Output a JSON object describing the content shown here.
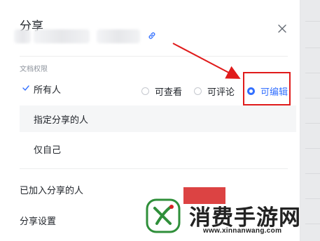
{
  "dialog": {
    "title": "分享",
    "close_icon": "close-icon",
    "link_icon": "link-icon"
  },
  "permissions": {
    "section_label": "文档权限",
    "rows": [
      {
        "label": "所有人",
        "checked": true
      },
      {
        "label": "指定分享的人",
        "checked": false
      },
      {
        "label": "仅自己",
        "checked": false
      }
    ],
    "options": [
      {
        "label": "可查看",
        "selected": false
      },
      {
        "label": "可评论",
        "selected": false
      },
      {
        "label": "可编辑",
        "selected": true
      }
    ]
  },
  "rows": {
    "joined": "已加入分享的人",
    "settings": "分享设置"
  },
  "colors": {
    "accent": "#3370ff",
    "highlight": "#e01b1b",
    "logo_green": "#2f8f3a"
  },
  "watermark": {
    "title": "消费手游网",
    "url": "www.xinnanwang.com"
  }
}
